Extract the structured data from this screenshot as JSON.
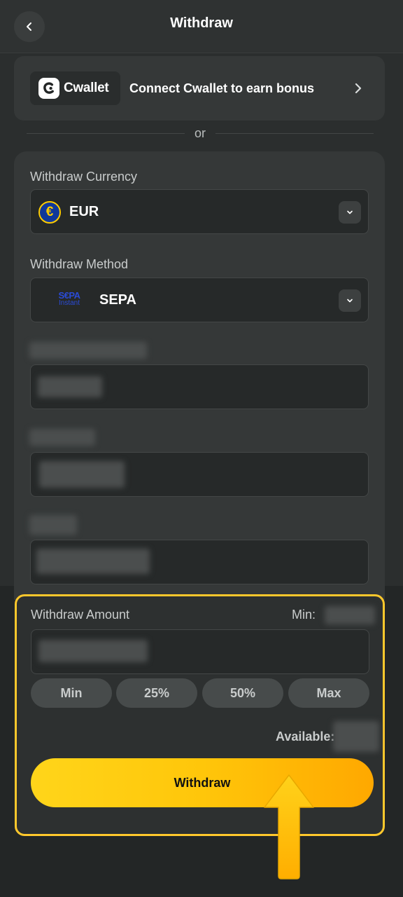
{
  "header": {
    "title": "Withdraw"
  },
  "cwallet": {
    "brand": "Cwallet",
    "text": "Connect Cwallet to earn bonus"
  },
  "divider": {
    "text": "or"
  },
  "currency": {
    "label": "Withdraw Currency",
    "value": "EUR",
    "icon": "euro-icon"
  },
  "method": {
    "label": "Withdraw Method",
    "value": "SEPA",
    "logo_top": "S€PA",
    "logo_bottom": "Instant"
  },
  "amount": {
    "label": "Withdraw Amount",
    "min_label": "Min:",
    "quick": [
      "Min",
      "25%",
      "50%",
      "Max"
    ],
    "available_label": "Available:",
    "submit_label": "Withdraw"
  },
  "colors": {
    "accent": "#ffc82c",
    "background": "#232626",
    "card": "#353838"
  }
}
